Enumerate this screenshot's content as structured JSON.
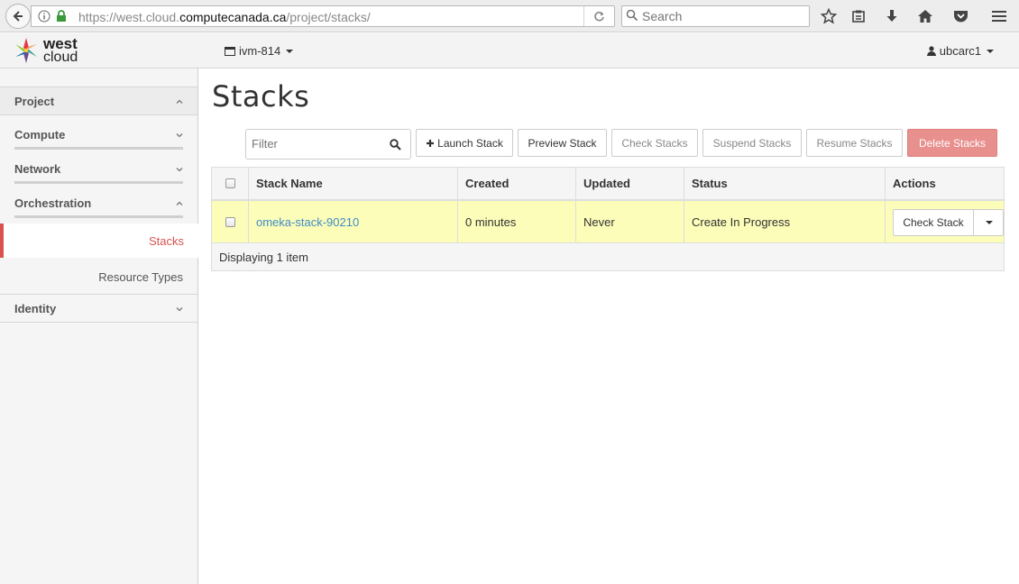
{
  "browser": {
    "url_prefix": "https://west.cloud.",
    "url_domain": "computecanada.ca",
    "url_path": "/project/stacks/",
    "search_placeholder": "Search"
  },
  "header": {
    "logo_line1": "west",
    "logo_line2": "cloud",
    "project": "ivm-814",
    "user": "ubcarc1"
  },
  "sidebar": {
    "project": "Project",
    "compute": "Compute",
    "network": "Network",
    "orchestration": "Orchestration",
    "stacks": "Stacks",
    "resource_types": "Resource Types",
    "identity": "Identity"
  },
  "main": {
    "title": "Stacks",
    "filter_placeholder": "Filter",
    "buttons": {
      "launch": "Launch Stack",
      "preview": "Preview Stack",
      "check": "Check Stacks",
      "suspend": "Suspend Stacks",
      "resume": "Resume Stacks",
      "delete": "Delete Stacks"
    },
    "table": {
      "headers": [
        "Stack Name",
        "Created",
        "Updated",
        "Status",
        "Actions"
      ],
      "rows": [
        {
          "name": "omeka-stack-90210",
          "created": "0 minutes",
          "updated": "Never",
          "status": "Create In Progress",
          "action": "Check Stack"
        }
      ],
      "footer": "Displaying 1 item"
    }
  },
  "colors": {
    "accent": "#d9534f",
    "link": "#428bca",
    "row_highlight": "#fbfdb9",
    "danger_button": "#e8908e"
  }
}
